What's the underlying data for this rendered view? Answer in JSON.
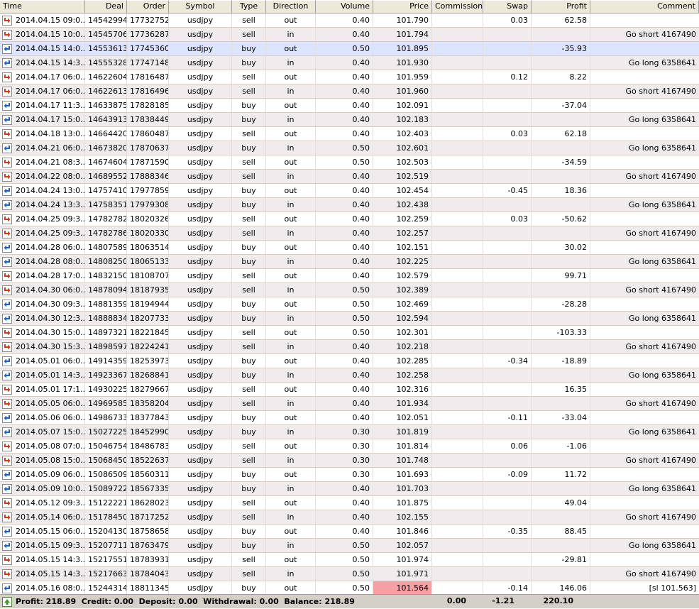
{
  "columns": {
    "time": "Time",
    "deal": "Deal",
    "order": "Order",
    "symbol": "Symbol",
    "type": "Type",
    "direction": "Direction",
    "volume": "Volume",
    "price": "Price",
    "commission": "Commission",
    "swap": "Swap",
    "profit": "Profit",
    "comment": "Comment"
  },
  "rows": [
    {
      "time": "2014.04.15 09:0...",
      "deal": "14542994",
      "order": "17732752",
      "symbol": "usdjpy",
      "type": "sell",
      "direction": "out",
      "volume": "0.40",
      "price": "101.790",
      "commission": "",
      "swap": "0.03",
      "profit": "62.58",
      "comment": ""
    },
    {
      "time": "2014.04.15 10:0...",
      "deal": "14545706",
      "order": "17736287",
      "symbol": "usdjpy",
      "type": "sell",
      "direction": "in",
      "volume": "0.40",
      "price": "101.794",
      "commission": "",
      "swap": "",
      "profit": "",
      "comment": "Go short 4167490"
    },
    {
      "time": "2014.04.15 14:0...",
      "deal": "14553613",
      "order": "17745360",
      "symbol": "usdjpy",
      "type": "buy",
      "direction": "out",
      "volume": "0.50",
      "price": "101.895",
      "commission": "",
      "swap": "",
      "profit": "-35.93",
      "comment": ""
    },
    {
      "time": "2014.04.15 14:3...",
      "deal": "14555328",
      "order": "17747148",
      "symbol": "usdjpy",
      "type": "buy",
      "direction": "in",
      "volume": "0.40",
      "price": "101.930",
      "commission": "",
      "swap": "",
      "profit": "",
      "comment": "Go long 6358641"
    },
    {
      "time": "2014.04.17 06:0...",
      "deal": "14622604",
      "order": "17816487",
      "symbol": "usdjpy",
      "type": "sell",
      "direction": "out",
      "volume": "0.40",
      "price": "101.959",
      "commission": "",
      "swap": "0.12",
      "profit": "8.22",
      "comment": ""
    },
    {
      "time": "2014.04.17 06:0...",
      "deal": "14622613",
      "order": "17816496",
      "symbol": "usdjpy",
      "type": "sell",
      "direction": "in",
      "volume": "0.40",
      "price": "101.960",
      "commission": "",
      "swap": "",
      "profit": "",
      "comment": "Go short 4167490"
    },
    {
      "time": "2014.04.17 11:3...",
      "deal": "14633875",
      "order": "17828185",
      "symbol": "usdjpy",
      "type": "buy",
      "direction": "out",
      "volume": "0.40",
      "price": "102.091",
      "commission": "",
      "swap": "",
      "profit": "-37.04",
      "comment": ""
    },
    {
      "time": "2014.04.17 15:0...",
      "deal": "14643913",
      "order": "17838449",
      "symbol": "usdjpy",
      "type": "buy",
      "direction": "in",
      "volume": "0.40",
      "price": "102.183",
      "commission": "",
      "swap": "",
      "profit": "",
      "comment": "Go long 6358641"
    },
    {
      "time": "2014.04.18 13:0...",
      "deal": "14664420",
      "order": "17860487",
      "symbol": "usdjpy",
      "type": "sell",
      "direction": "out",
      "volume": "0.40",
      "price": "102.403",
      "commission": "",
      "swap": "0.03",
      "profit": "62.18",
      "comment": ""
    },
    {
      "time": "2014.04.21 06:0...",
      "deal": "14673820",
      "order": "17870637",
      "symbol": "usdjpy",
      "type": "buy",
      "direction": "in",
      "volume": "0.50",
      "price": "102.601",
      "commission": "",
      "swap": "",
      "profit": "",
      "comment": "Go long 6358641"
    },
    {
      "time": "2014.04.21 08:3...",
      "deal": "14674604",
      "order": "17871590",
      "symbol": "usdjpy",
      "type": "sell",
      "direction": "out",
      "volume": "0.50",
      "price": "102.503",
      "commission": "",
      "swap": "",
      "profit": "-34.59",
      "comment": ""
    },
    {
      "time": "2014.04.22 08:0...",
      "deal": "14689552",
      "order": "17888346",
      "symbol": "usdjpy",
      "type": "sell",
      "direction": "in",
      "volume": "0.40",
      "price": "102.519",
      "commission": "",
      "swap": "",
      "profit": "",
      "comment": "Go short 4167490"
    },
    {
      "time": "2014.04.24 13:0...",
      "deal": "14757410",
      "order": "17977859",
      "symbol": "usdjpy",
      "type": "buy",
      "direction": "out",
      "volume": "0.40",
      "price": "102.454",
      "commission": "",
      "swap": "-0.45",
      "profit": "18.36",
      "comment": ""
    },
    {
      "time": "2014.04.24 13:3...",
      "deal": "14758351",
      "order": "17979308",
      "symbol": "usdjpy",
      "type": "buy",
      "direction": "in",
      "volume": "0.40",
      "price": "102.438",
      "commission": "",
      "swap": "",
      "profit": "",
      "comment": "Go long 6358641"
    },
    {
      "time": "2014.04.25 09:3...",
      "deal": "14782782",
      "order": "18020326",
      "symbol": "usdjpy",
      "type": "sell",
      "direction": "out",
      "volume": "0.40",
      "price": "102.259",
      "commission": "",
      "swap": "0.03",
      "profit": "-50.62",
      "comment": ""
    },
    {
      "time": "2014.04.25 09:3...",
      "deal": "14782786",
      "order": "18020330",
      "symbol": "usdjpy",
      "type": "sell",
      "direction": "in",
      "volume": "0.40",
      "price": "102.257",
      "commission": "",
      "swap": "",
      "profit": "",
      "comment": "Go short 4167490"
    },
    {
      "time": "2014.04.28 06:0...",
      "deal": "14807589",
      "order": "18063514",
      "symbol": "usdjpy",
      "type": "buy",
      "direction": "out",
      "volume": "0.40",
      "price": "102.151",
      "commission": "",
      "swap": "",
      "profit": "30.02",
      "comment": ""
    },
    {
      "time": "2014.04.28 08:0...",
      "deal": "14808250",
      "order": "18065133",
      "symbol": "usdjpy",
      "type": "buy",
      "direction": "in",
      "volume": "0.40",
      "price": "102.225",
      "commission": "",
      "swap": "",
      "profit": "",
      "comment": "Go long 6358641"
    },
    {
      "time": "2014.04.28 17:0...",
      "deal": "14832150",
      "order": "18108707",
      "symbol": "usdjpy",
      "type": "sell",
      "direction": "out",
      "volume": "0.40",
      "price": "102.579",
      "commission": "",
      "swap": "",
      "profit": "99.71",
      "comment": ""
    },
    {
      "time": "2014.04.30 06:0...",
      "deal": "14878094",
      "order": "18187935",
      "symbol": "usdjpy",
      "type": "sell",
      "direction": "in",
      "volume": "0.50",
      "price": "102.389",
      "commission": "",
      "swap": "",
      "profit": "",
      "comment": "Go short 4167490"
    },
    {
      "time": "2014.04.30 09:3...",
      "deal": "14881359",
      "order": "18194944",
      "symbol": "usdjpy",
      "type": "buy",
      "direction": "out",
      "volume": "0.50",
      "price": "102.469",
      "commission": "",
      "swap": "",
      "profit": "-28.28",
      "comment": ""
    },
    {
      "time": "2014.04.30 12:3...",
      "deal": "14888834",
      "order": "18207733",
      "symbol": "usdjpy",
      "type": "buy",
      "direction": "in",
      "volume": "0.50",
      "price": "102.594",
      "commission": "",
      "swap": "",
      "profit": "",
      "comment": "Go long 6358641"
    },
    {
      "time": "2014.04.30 15:0...",
      "deal": "14897321",
      "order": "18221845",
      "symbol": "usdjpy",
      "type": "sell",
      "direction": "out",
      "volume": "0.50",
      "price": "102.301",
      "commission": "",
      "swap": "",
      "profit": "-103.33",
      "comment": ""
    },
    {
      "time": "2014.04.30 15:3...",
      "deal": "14898597",
      "order": "18224241",
      "symbol": "usdjpy",
      "type": "sell",
      "direction": "in",
      "volume": "0.40",
      "price": "102.218",
      "commission": "",
      "swap": "",
      "profit": "",
      "comment": "Go short 4167490"
    },
    {
      "time": "2014.05.01 06:0...",
      "deal": "14914359",
      "order": "18253973",
      "symbol": "usdjpy",
      "type": "buy",
      "direction": "out",
      "volume": "0.40",
      "price": "102.285",
      "commission": "",
      "swap": "-0.34",
      "profit": "-18.89",
      "comment": ""
    },
    {
      "time": "2014.05.01 14:3...",
      "deal": "14923367",
      "order": "18268841",
      "symbol": "usdjpy",
      "type": "buy",
      "direction": "in",
      "volume": "0.40",
      "price": "102.258",
      "commission": "",
      "swap": "",
      "profit": "",
      "comment": "Go long 6358641"
    },
    {
      "time": "2014.05.01 17:1...",
      "deal": "14930225",
      "order": "18279667",
      "symbol": "usdjpy",
      "type": "sell",
      "direction": "out",
      "volume": "0.40",
      "price": "102.316",
      "commission": "",
      "swap": "",
      "profit": "16.35",
      "comment": ""
    },
    {
      "time": "2014.05.05 06:0...",
      "deal": "14969585",
      "order": "18358204",
      "symbol": "usdjpy",
      "type": "sell",
      "direction": "in",
      "volume": "0.40",
      "price": "101.934",
      "commission": "",
      "swap": "",
      "profit": "",
      "comment": "Go short 4167490"
    },
    {
      "time": "2014.05.06 06:0...",
      "deal": "14986733",
      "order": "18377843",
      "symbol": "usdjpy",
      "type": "buy",
      "direction": "out",
      "volume": "0.40",
      "price": "102.051",
      "commission": "",
      "swap": "-0.11",
      "profit": "-33.04",
      "comment": ""
    },
    {
      "time": "2014.05.07 15:0...",
      "deal": "15027225",
      "order": "18452990",
      "symbol": "usdjpy",
      "type": "buy",
      "direction": "in",
      "volume": "0.30",
      "price": "101.819",
      "commission": "",
      "swap": "",
      "profit": "",
      "comment": "Go long 6358641"
    },
    {
      "time": "2014.05.08 07:0...",
      "deal": "15046754",
      "order": "18486783",
      "symbol": "usdjpy",
      "type": "sell",
      "direction": "out",
      "volume": "0.30",
      "price": "101.814",
      "commission": "",
      "swap": "0.06",
      "profit": "-1.06",
      "comment": ""
    },
    {
      "time": "2014.05.08 15:0...",
      "deal": "15068450",
      "order": "18522637",
      "symbol": "usdjpy",
      "type": "sell",
      "direction": "in",
      "volume": "0.30",
      "price": "101.748",
      "commission": "",
      "swap": "",
      "profit": "",
      "comment": "Go short 4167490"
    },
    {
      "time": "2014.05.09 06:0...",
      "deal": "15086509",
      "order": "18560311",
      "symbol": "usdjpy",
      "type": "buy",
      "direction": "out",
      "volume": "0.30",
      "price": "101.693",
      "commission": "",
      "swap": "-0.09",
      "profit": "11.72",
      "comment": ""
    },
    {
      "time": "2014.05.09 10:0...",
      "deal": "15089722",
      "order": "18567335",
      "symbol": "usdjpy",
      "type": "buy",
      "direction": "in",
      "volume": "0.40",
      "price": "101.703",
      "commission": "",
      "swap": "",
      "profit": "",
      "comment": "Go long 6358641"
    },
    {
      "time": "2014.05.12 09:3...",
      "deal": "15122221",
      "order": "18628023",
      "symbol": "usdjpy",
      "type": "sell",
      "direction": "out",
      "volume": "0.40",
      "price": "101.875",
      "commission": "",
      "swap": "",
      "profit": "49.04",
      "comment": ""
    },
    {
      "time": "2014.05.14 06:0...",
      "deal": "15178450",
      "order": "18717252",
      "symbol": "usdjpy",
      "type": "sell",
      "direction": "in",
      "volume": "0.40",
      "price": "102.155",
      "commission": "",
      "swap": "",
      "profit": "",
      "comment": "Go short 4167490"
    },
    {
      "time": "2014.05.15 06:0...",
      "deal": "15204130",
      "order": "18758658",
      "symbol": "usdjpy",
      "type": "buy",
      "direction": "out",
      "volume": "0.40",
      "price": "101.846",
      "commission": "",
      "swap": "-0.35",
      "profit": "88.45",
      "comment": ""
    },
    {
      "time": "2014.05.15 09:3...",
      "deal": "15207711",
      "order": "18763479",
      "symbol": "usdjpy",
      "type": "buy",
      "direction": "in",
      "volume": "0.50",
      "price": "102.057",
      "commission": "",
      "swap": "",
      "profit": "",
      "comment": "Go long 6358641"
    },
    {
      "time": "2014.05.15 14:3...",
      "deal": "15217551",
      "order": "18783931",
      "symbol": "usdjpy",
      "type": "sell",
      "direction": "out",
      "volume": "0.50",
      "price": "101.974",
      "commission": "",
      "swap": "",
      "profit": "-29.81",
      "comment": ""
    },
    {
      "time": "2014.05.15 14:3...",
      "deal": "15217663",
      "order": "18784043",
      "symbol": "usdjpy",
      "type": "sell",
      "direction": "in",
      "volume": "0.50",
      "price": "101.971",
      "commission": "",
      "swap": "",
      "profit": "",
      "comment": "Go short 4167490"
    },
    {
      "time": "2014.05.16 08:0...",
      "deal": "15244314",
      "order": "18811345",
      "symbol": "usdjpy",
      "type": "buy",
      "direction": "out",
      "volume": "0.50",
      "price": "101.564",
      "commission": "",
      "swap": "-0.14",
      "profit": "146.06",
      "comment": "[sl 101.563]"
    }
  ],
  "footer": {
    "summary": "Profit: 218.89  Credit: 0.00  Deposit: 0.00  Withdrawal: 0.00  Balance: 218.89",
    "commission_total": "0.00",
    "swap_total": "-1.21",
    "profit_total": "220.10"
  },
  "colors": {
    "selected_row": "#dde4ff",
    "alt_row": "#f0ecee",
    "stop_loss_price": "#f7a0a4",
    "buy_arrow": "#1f5fd0",
    "sell_arrow": "#d23a1c"
  }
}
